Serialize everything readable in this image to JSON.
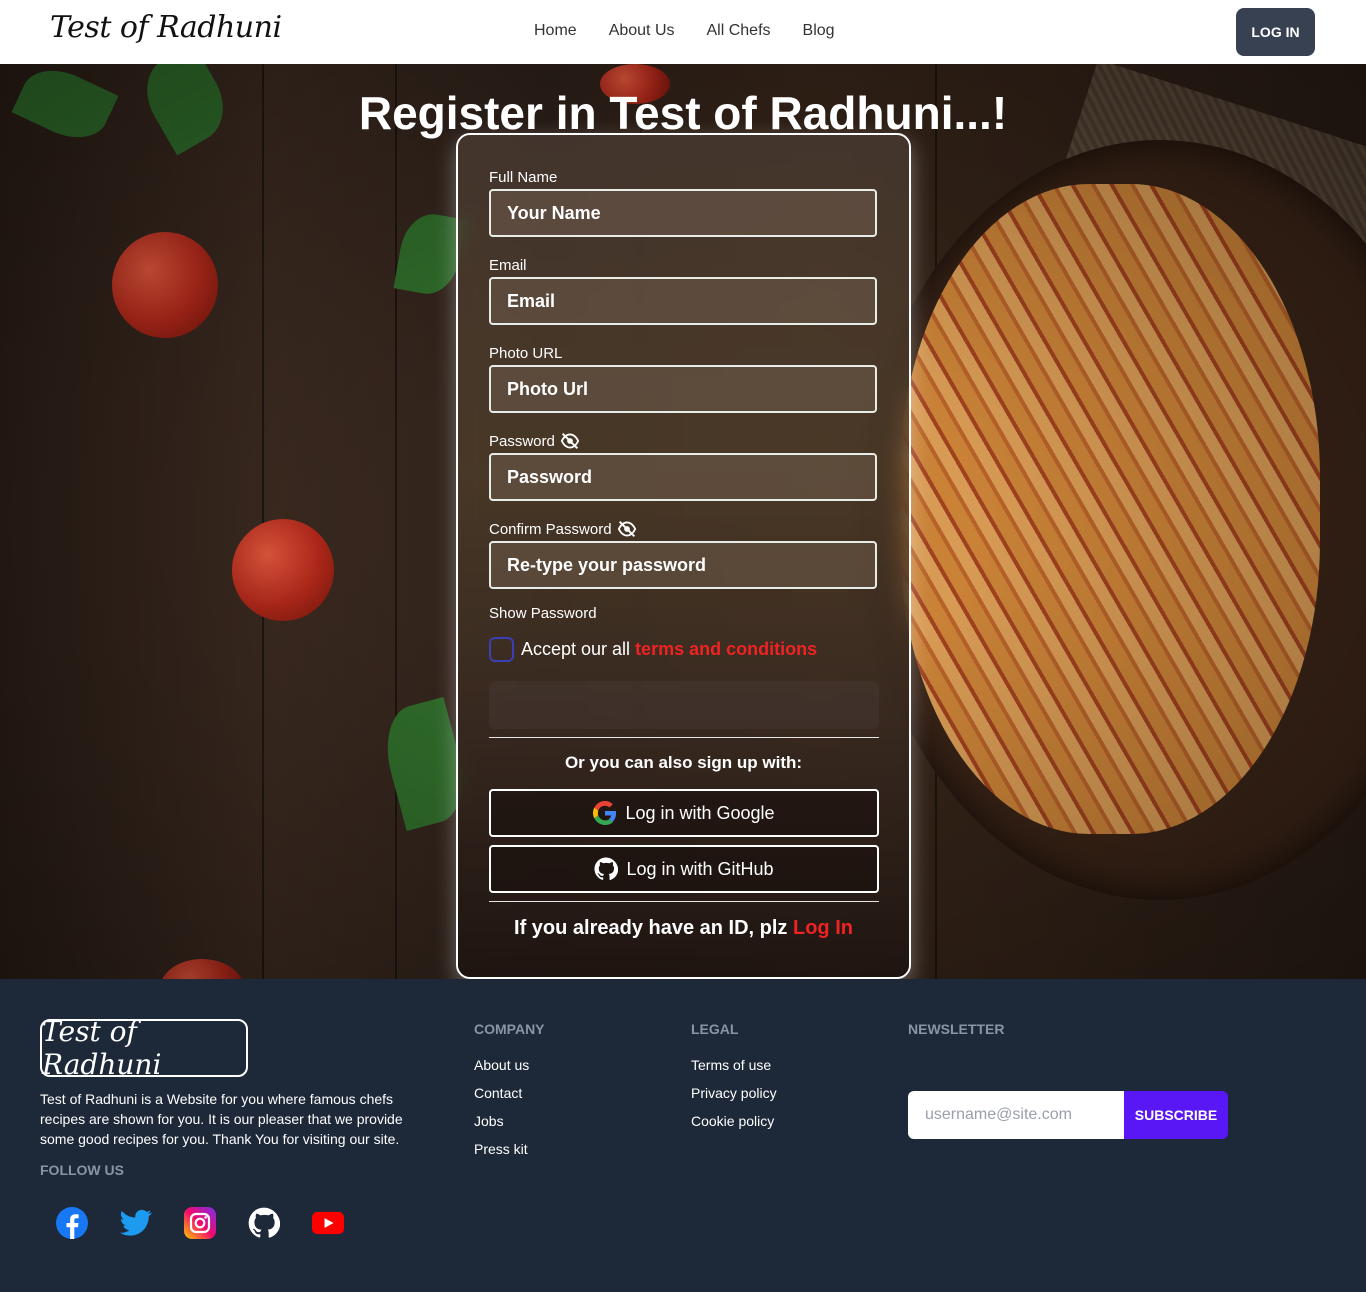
{
  "navbar": {
    "brand": "Test of Radhuni",
    "links": [
      "Home",
      "About Us",
      "All Chefs",
      "Blog"
    ],
    "login_label": "LOG IN"
  },
  "hero": {
    "title": "Register in Test of Radhuni...!"
  },
  "form": {
    "full_name": {
      "label": "Full Name",
      "placeholder": "Your Name"
    },
    "email": {
      "label": "Email",
      "placeholder": "Email"
    },
    "photo_url": {
      "label": "Photo URL",
      "placeholder": "Photo Url"
    },
    "password": {
      "label": "Password",
      "placeholder": "Password",
      "icon": "eye-off-icon"
    },
    "confirm_password": {
      "label": "Confirm Password",
      "placeholder": "Re-type your password",
      "icon": "eye-off-icon"
    },
    "show_password": "Show Password",
    "terms_prefix": "Accept our all",
    "terms_link": "terms and conditions",
    "or_text": "Or you can also sign up with:",
    "google_label": "Log in with Google",
    "github_label": "Log in with GitHub",
    "already_text": "If you already have an ID, plz",
    "already_link": "Log In"
  },
  "footer": {
    "logo": "Test of Radhuni",
    "description": "Test of Radhuni is a Website for you where famous chefs recipes are shown for you. It is our pleaser that we provide some good recipes for you. Thank You for visiting our site.",
    "follow_label": "FOLLOW US",
    "social": [
      "facebook-icon",
      "twitter-icon",
      "instagram-icon",
      "github-icon",
      "youtube-icon"
    ],
    "company": {
      "title": "COMPANY",
      "links": [
        "About us",
        "Contact",
        "Jobs",
        "Press kit"
      ]
    },
    "legal": {
      "title": "LEGAL",
      "links": [
        "Terms of use",
        "Privacy policy",
        "Cookie policy"
      ]
    },
    "newsletter": {
      "title": "NEWSLETTER",
      "placeholder": "username@site.com",
      "button": "SUBSCRIBE"
    }
  },
  "colors": {
    "accent_red": "#ee2323",
    "footer_bg": "#1d2838",
    "subscribe": "#5a17f5",
    "login_btn": "#384152"
  }
}
